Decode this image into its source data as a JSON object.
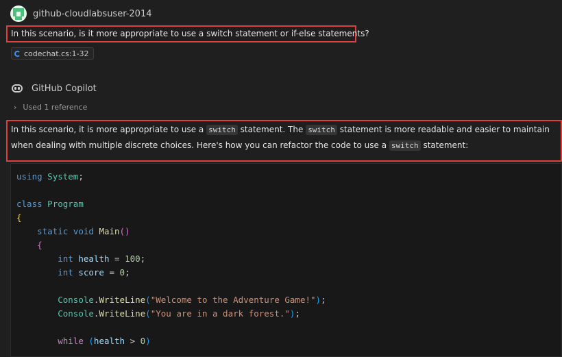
{
  "user": {
    "name": "github-cloudlabsuser-2014",
    "question": "In this scenario, is it more appropriate to use a switch statement or if-else statements?",
    "reference_chip": "codechat.cs:1-32"
  },
  "assistant": {
    "name": "GitHub Copilot",
    "used_references": "Used 1 reference",
    "answer": {
      "part1": "In this scenario, it is more appropriate to use a ",
      "code1": "switch",
      "part2": " statement. The ",
      "code2": "switch",
      "part3": " statement is more readable and easier to maintain when dealing with multiple discrete choices. Here's how you can refactor the code to use a ",
      "code3": "switch",
      "part4": " statement:"
    }
  },
  "code": {
    "language": "csharp",
    "lines": [
      [
        {
          "t": "using",
          "c": "kw"
        },
        {
          "t": " "
        },
        {
          "t": "System",
          "c": "type"
        },
        {
          "t": ";"
        }
      ],
      [],
      [
        {
          "t": "class",
          "c": "kw"
        },
        {
          "t": " "
        },
        {
          "t": "Program",
          "c": "type"
        }
      ],
      [
        {
          "t": "{",
          "c": "brace1"
        }
      ],
      [
        {
          "t": "    "
        },
        {
          "t": "static",
          "c": "kw"
        },
        {
          "t": " "
        },
        {
          "t": "void",
          "c": "kw"
        },
        {
          "t": " "
        },
        {
          "t": "Main",
          "c": "fn"
        },
        {
          "t": "()",
          "c": "brace2"
        }
      ],
      [
        {
          "t": "    "
        },
        {
          "t": "{",
          "c": "brace2"
        }
      ],
      [
        {
          "t": "        "
        },
        {
          "t": "int",
          "c": "kw"
        },
        {
          "t": " "
        },
        {
          "t": "health",
          "c": "var"
        },
        {
          "t": " = "
        },
        {
          "t": "100",
          "c": "num"
        },
        {
          "t": ";"
        }
      ],
      [
        {
          "t": "        "
        },
        {
          "t": "int",
          "c": "kw"
        },
        {
          "t": " "
        },
        {
          "t": "score",
          "c": "var"
        },
        {
          "t": " = "
        },
        {
          "t": "0",
          "c": "num"
        },
        {
          "t": ";"
        }
      ],
      [],
      [
        {
          "t": "        "
        },
        {
          "t": "Console",
          "c": "type"
        },
        {
          "t": "."
        },
        {
          "t": "WriteLine",
          "c": "fn"
        },
        {
          "t": "(",
          "c": "brace3"
        },
        {
          "t": "\"Welcome to the Adventure Game!\"",
          "c": "str"
        },
        {
          "t": ")",
          "c": "brace3"
        },
        {
          "t": ";"
        }
      ],
      [
        {
          "t": "        "
        },
        {
          "t": "Console",
          "c": "type"
        },
        {
          "t": "."
        },
        {
          "t": "WriteLine",
          "c": "fn"
        },
        {
          "t": "(",
          "c": "brace3"
        },
        {
          "t": "\"You are in a dark forest.\"",
          "c": "str"
        },
        {
          "t": ")",
          "c": "brace3"
        },
        {
          "t": ";"
        }
      ],
      [],
      [
        {
          "t": "        "
        },
        {
          "t": "while",
          "c": "ctl"
        },
        {
          "t": " "
        },
        {
          "t": "(",
          "c": "brace3"
        },
        {
          "t": "health",
          "c": "var"
        },
        {
          "t": " > "
        },
        {
          "t": "0",
          "c": "num"
        },
        {
          "t": ")",
          "c": "brace3"
        }
      ]
    ]
  },
  "colors": {
    "highlight_border": "#e0403a",
    "background": "#1f1f1f",
    "avatar_green": "#4ebd7d"
  },
  "icons": {
    "avatar": "identicon-avatar",
    "reference": "csharp-file-icon",
    "copilot": "copilot-icon",
    "expand": "chevron-right-icon"
  }
}
